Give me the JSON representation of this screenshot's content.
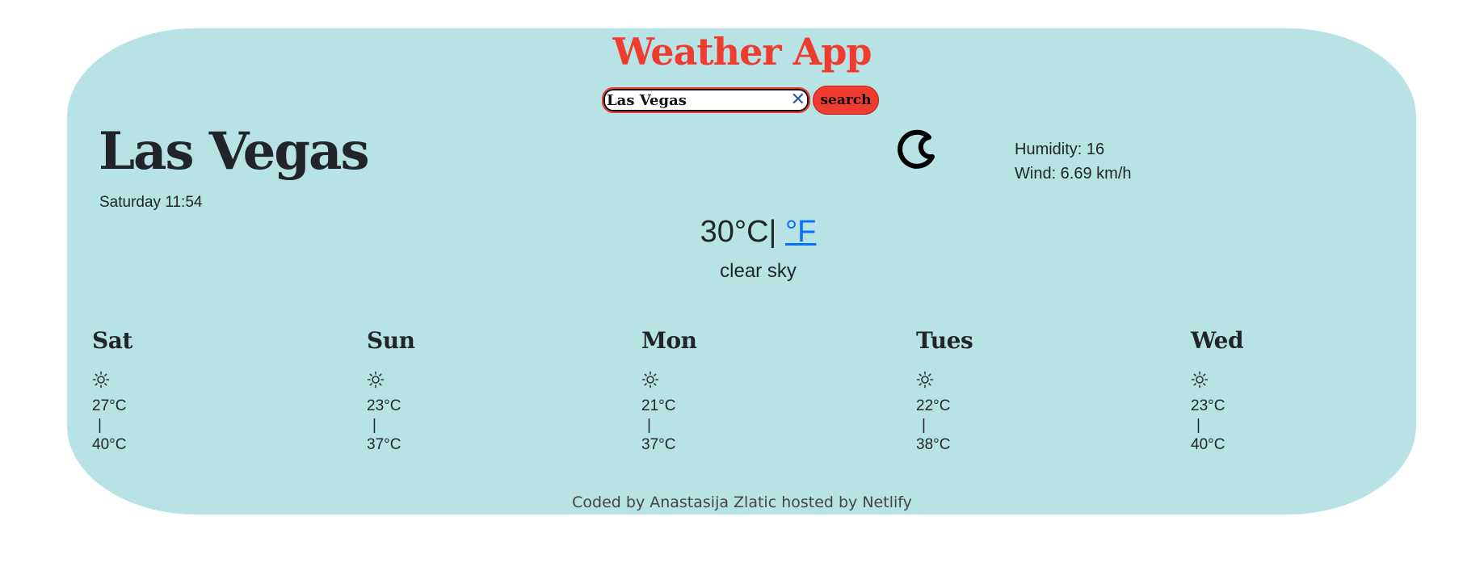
{
  "app": {
    "title": "Weather App"
  },
  "search": {
    "value": "Las Vegas",
    "clear_icon": "close-icon",
    "button_label": "search"
  },
  "current": {
    "city": "Las Vegas",
    "date_time": "Saturday 11:54",
    "icon": "moon-icon",
    "humidity": "Humidity: 16",
    "wind": "Wind: 6.69 km/h",
    "temperature_celsius": "30°C|",
    "fahrenheit_link": "°F",
    "description": "clear sky"
  },
  "forecast": [
    {
      "day": "Sat",
      "icon": "sun-icon",
      "min": "27°C",
      "separator": "|",
      "max": "40°C"
    },
    {
      "day": "Sun",
      "icon": "sun-icon",
      "min": "23°C",
      "separator": "|",
      "max": "37°C"
    },
    {
      "day": "Mon",
      "icon": "sun-icon",
      "min": "21°C",
      "separator": "|",
      "max": "37°C"
    },
    {
      "day": "Tues",
      "icon": "sun-icon",
      "min": "22°C",
      "separator": "|",
      "max": "38°C"
    },
    {
      "day": "Wed",
      "icon": "sun-icon",
      "min": "23°C",
      "separator": "|",
      "max": "40°C"
    }
  ],
  "footer": {
    "text": "Coded by Anastasija Zlatic hosted by Netlify"
  },
  "colors": {
    "card_background": "#b8e3e4",
    "accent": "#ef3b30",
    "link": "#0d6efd"
  }
}
